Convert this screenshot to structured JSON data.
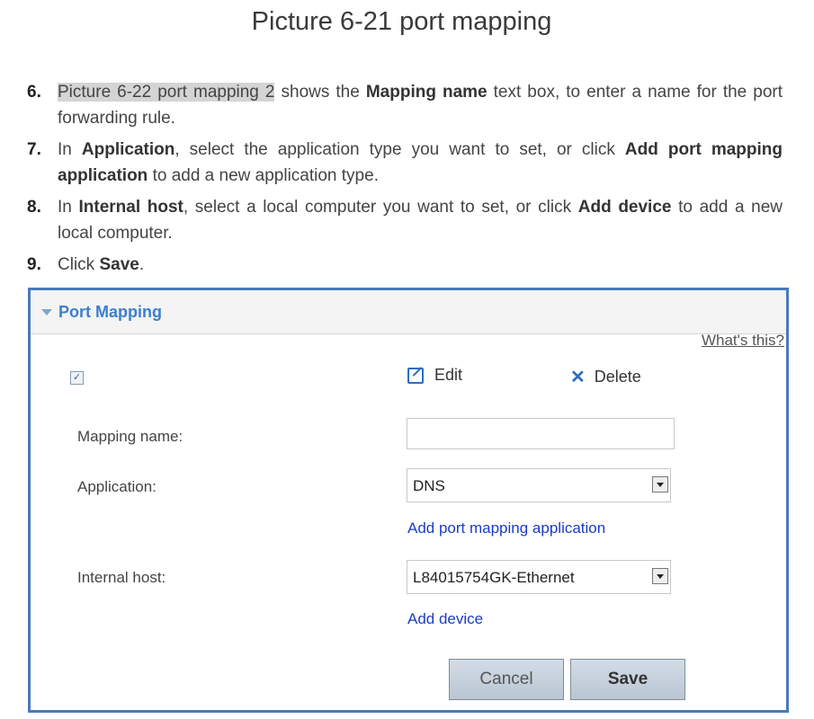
{
  "page_title": "Picture 6-21 port mapping",
  "steps": [
    {
      "num": "6.",
      "ref": "Picture 6-22 port mapping 2",
      "t1": " shows the ",
      "b1": "Mapping name",
      "t2": " text box, to enter a name for the port forwarding rule."
    },
    {
      "num": "7.",
      "t1": "In ",
      "b1": "Application",
      "t2": ", select the application type you want to set, or click ",
      "b2": "Add port mapping application",
      "t3": " to add a new application type."
    },
    {
      "num": "8.",
      "t1": "In ",
      "b1": "Internal host",
      "t2": ", select a local computer you want to set, or click ",
      "b2": "Add device",
      "t3": " to add a new local computer."
    },
    {
      "num": "9.",
      "t1": "Click ",
      "b1": "Save",
      "t2": "."
    }
  ],
  "panel": {
    "title": "Port Mapping",
    "whats_this": "What's this?",
    "checkbox_mark": "✓",
    "edit_label": "Edit",
    "delete_label": "Delete",
    "delete_glyph": "✕",
    "mapping_name_label": "Mapping name:",
    "mapping_name_value": "",
    "application_label": "Application:",
    "application_value": "DNS",
    "add_app_link": "Add port mapping application",
    "internal_host_label": "Internal host:",
    "internal_host_value": "L84015754GK-Ethernet",
    "add_device_link": "Add device",
    "cancel_label": "Cancel",
    "save_label": "Save"
  }
}
